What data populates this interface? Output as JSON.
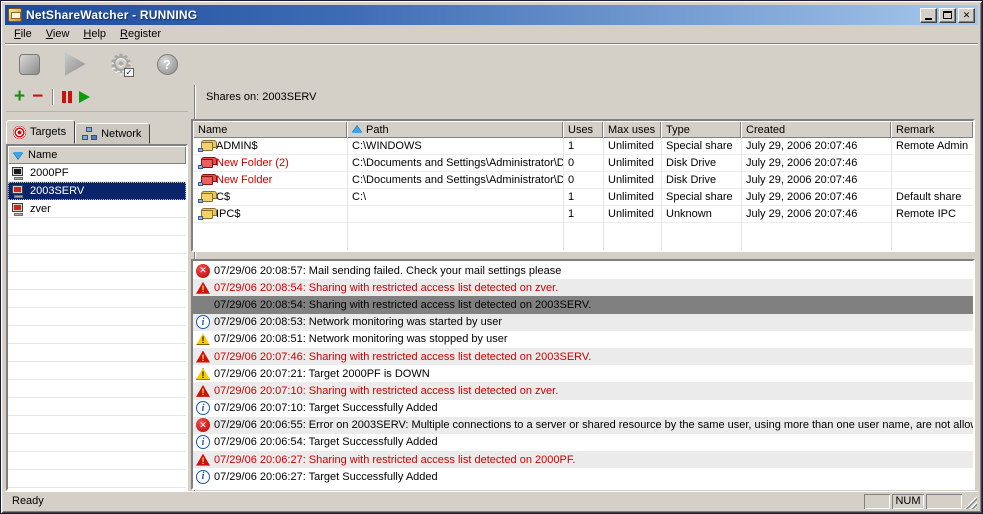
{
  "window": {
    "title": "NetShareWatcher - RUNNING",
    "close_glyph": "x"
  },
  "glyphs": {
    "x": "✕",
    "question": "?",
    "gear": "⚙",
    "check": "✓",
    "info_i": "i",
    "excl": "!",
    "plus": "+",
    "minus": "−"
  },
  "menu": {
    "items": [
      {
        "u": "F",
        "rest": "ile"
      },
      {
        "u": "V",
        "rest": "iew"
      },
      {
        "u": "H",
        "rest": "elp"
      },
      {
        "u": "R",
        "rest": "egister"
      }
    ]
  },
  "targets_panel": {
    "tabs": [
      {
        "label": "Targets"
      },
      {
        "label": "Network"
      }
    ],
    "list_header": "Name",
    "items": [
      {
        "name": "2000PF",
        "status": "down",
        "selected": false
      },
      {
        "name": "2003SERV",
        "status": "alert",
        "selected": true
      },
      {
        "name": "zver",
        "status": "alert",
        "selected": false
      }
    ]
  },
  "shares_panel": {
    "title": "Shares on: 2003SERV",
    "columns": [
      "Name",
      "Path",
      "Uses",
      "Max uses",
      "Type",
      "Created",
      "Remark"
    ],
    "rows": [
      {
        "name": "ADMIN$",
        "path": "C:\\WINDOWS",
        "uses": "1",
        "max_uses": "Unlimited",
        "type": "Special share",
        "created": "July 29, 2006 20:07:46",
        "remark": "Remote Admin",
        "alert": false
      },
      {
        "name": "New Folder (2)",
        "path": "C:\\Documents and Settings\\Administrator\\Des",
        "uses": "0",
        "max_uses": "Unlimited",
        "type": "Disk Drive",
        "created": "July 29, 2006 20:07:46",
        "remark": "",
        "alert": true
      },
      {
        "name": "New Folder",
        "path": "C:\\Documents and Settings\\Administrator\\Des",
        "uses": "0",
        "max_uses": "Unlimited",
        "type": "Disk Drive",
        "created": "July 29, 2006 20:07:46",
        "remark": "",
        "alert": true
      },
      {
        "name": "C$",
        "path": "C:\\",
        "uses": "1",
        "max_uses": "Unlimited",
        "type": "Special share",
        "created": "July 29, 2006 20:07:46",
        "remark": "Default share",
        "alert": false
      },
      {
        "name": "IPC$",
        "path": "",
        "uses": "1",
        "max_uses": "Unlimited",
        "type": "Unknown",
        "created": "July 29, 2006 20:07:46",
        "remark": "Remote IPC",
        "alert": false
      }
    ]
  },
  "log_panel": {
    "items": [
      {
        "icon": "error",
        "text": "07/29/06 20:08:57: Mail sending failed. Check your mail settings please",
        "red": false,
        "selected": false
      },
      {
        "icon": "warn-red",
        "text": "07/29/06 20:08:54: Sharing with restricted access list detected on zver.",
        "red": true,
        "selected": false
      },
      {
        "icon": "none",
        "text": "07/29/06 20:08:54: Sharing with restricted access list detected on 2003SERV.",
        "red": false,
        "selected": true
      },
      {
        "icon": "info",
        "text": "07/29/06 20:08:53: Network monitoring was started by user",
        "red": false,
        "selected": false
      },
      {
        "icon": "warn-yel",
        "text": "07/29/06 20:08:51: Network monitoring was stopped by user",
        "red": false,
        "selected": false
      },
      {
        "icon": "warn-red",
        "text": "07/29/06 20:07:46: Sharing with restricted access list detected on 2003SERV.",
        "red": true,
        "selected": false
      },
      {
        "icon": "warn-yel",
        "text": "07/29/06 20:07:21: Target 2000PF is DOWN",
        "red": false,
        "selected": false
      },
      {
        "icon": "warn-red",
        "text": "07/29/06 20:07:10: Sharing with restricted access list detected on zver.",
        "red": true,
        "selected": false
      },
      {
        "icon": "info",
        "text": "07/29/06 20:07:10: Target Successfully Added",
        "red": false,
        "selected": false
      },
      {
        "icon": "error",
        "text": "07/29/06 20:06:55: Error on 2003SERV: Multiple connections to a server or shared resource by the same user, using more than one user name, are not allow",
        "red": false,
        "selected": false
      },
      {
        "icon": "info",
        "text": "07/29/06 20:06:54: Target Successfully Added",
        "red": false,
        "selected": false
      },
      {
        "icon": "warn-red",
        "text": "07/29/06 20:06:27: Sharing with restricted access list detected on 2000PF.",
        "red": true,
        "selected": false
      },
      {
        "icon": "info",
        "text": "07/29/06 20:06:27: Target Successfully Added",
        "red": false,
        "selected": false
      }
    ]
  },
  "status_bar": {
    "text": "Ready",
    "num": "NUM"
  }
}
